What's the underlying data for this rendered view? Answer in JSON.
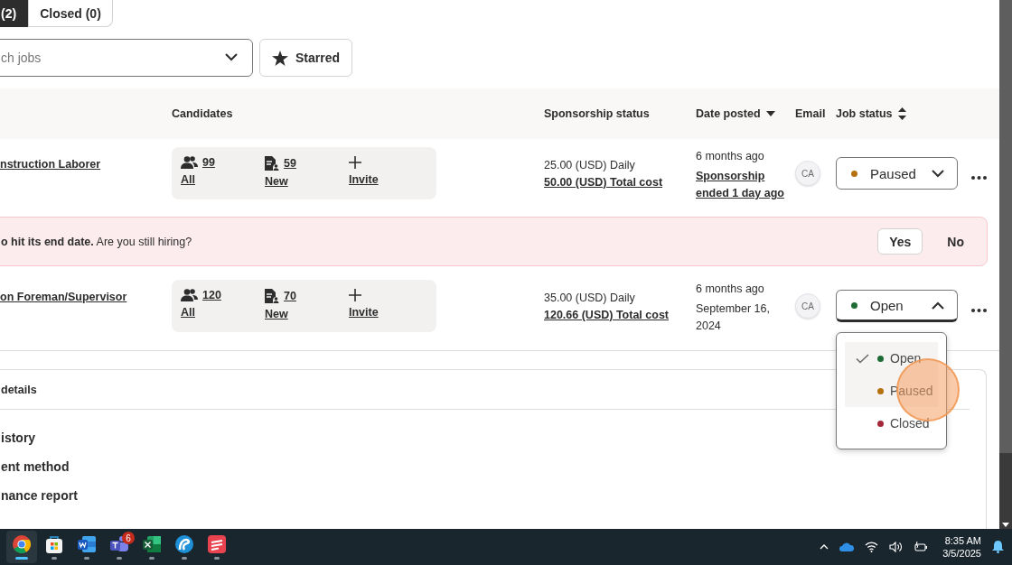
{
  "tabs": [
    {
      "label": "(2)",
      "selected": true
    },
    {
      "label": "Closed (0)",
      "selected": false
    }
  ],
  "search": {
    "placeholder": "ch jobs"
  },
  "starred_button": {
    "label": "Starred"
  },
  "table": {
    "columns": [
      {
        "label": "Candidates",
        "kind": "plain"
      },
      {
        "label": "Sponsorship status",
        "kind": "plain"
      },
      {
        "label": "Date posted",
        "kind": "sorted"
      },
      {
        "label": "Email",
        "kind": "plain"
      },
      {
        "label": "Job status",
        "kind": "sortable"
      }
    ],
    "rows": [
      {
        "kind": "job",
        "title": "nstruction Laborer",
        "all_count": "99",
        "all_label": "All",
        "new_count": "59",
        "new_label": "New",
        "invite_label": "Invite",
        "budget": "25.00 (USD) Daily",
        "total_cost": "50.00 (USD) Total cost",
        "date": "6 months ago",
        "date_link": "Sponsorship ended 1 day ago",
        "initials": "CA",
        "status": {
          "label": "Paused",
          "color": "#b5700f",
          "expanded": false
        }
      },
      {
        "kind": "alert",
        "text": "**o hit its end date.** Are you still hiring?",
        "buttons": [
          {
            "label": "Yes",
            "outlined": true
          },
          {
            "label": "No",
            "outlined": false
          }
        ]
      },
      {
        "kind": "job",
        "title": "on Foreman/Supervisor",
        "all_count": "120",
        "all_label": "All",
        "new_count": "70",
        "new_label": "New",
        "invite_label": "Invite",
        "budget": "35.00 (USD) Daily",
        "total_cost": "120.66 (USD) Total cost",
        "date": "6 months ago",
        "date_detail": "September 16, 2024",
        "initials": "CA",
        "status": {
          "label": "Open",
          "color": "#1f6b36",
          "expanded": true,
          "options": [
            {
              "label": "Open",
              "color": "#1f6b36",
              "selected": true,
              "hovered": false
            },
            {
              "label": "Paused",
              "color": "#b5700f",
              "selected": false,
              "hovered": true
            },
            {
              "label": "Closed",
              "color": "#a4283a",
              "selected": false,
              "hovered": false
            }
          ]
        }
      }
    ]
  },
  "details_card": {
    "title": "details",
    "links": [
      "istory",
      "ent method",
      "nance report"
    ]
  },
  "taskbar": {
    "apps": [
      {
        "kind": "chrome",
        "active": true
      },
      {
        "kind": "store",
        "active": false
      },
      {
        "kind": "word",
        "active": false
      },
      {
        "kind": "teams",
        "active": false,
        "badge": "6"
      },
      {
        "kind": "excel",
        "active": false
      },
      {
        "kind": "edge",
        "active": false
      },
      {
        "kind": "red",
        "active": false
      }
    ],
    "time": "8:35 AM",
    "date": "3/5/2025"
  }
}
